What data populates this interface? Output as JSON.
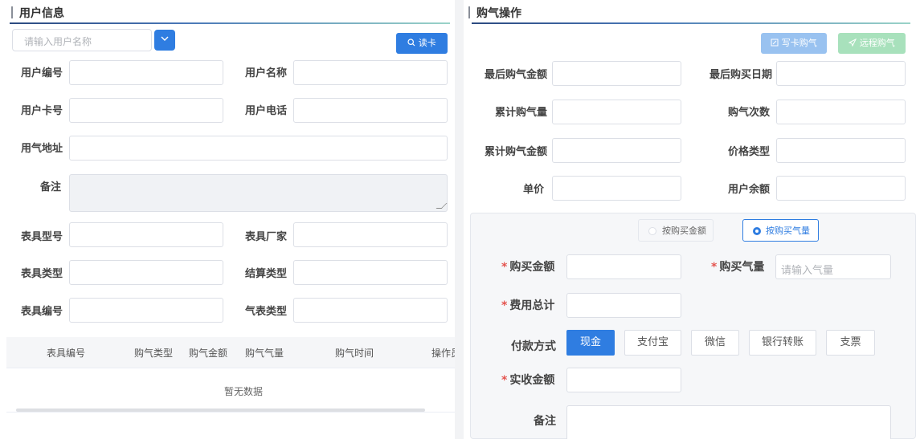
{
  "user_info": {
    "title": "用户信息",
    "search_placeholder": "请输入用户名称",
    "read_card_label": "读卡",
    "labels": {
      "user_no": "用户编号",
      "user_name": "用户名称",
      "card_no": "用户卡号",
      "phone": "用户电话",
      "address": "用气地址",
      "remark": "备注",
      "meter_model": "表具型号",
      "meter_maker": "表具厂家",
      "meter_type": "表具类型",
      "settle_type": "结算类型",
      "meter_no": "表具编号",
      "gas_meter_type": "气表类型"
    }
  },
  "table": {
    "columns": [
      "表具编号",
      "购气类型",
      "购气金额",
      "购气气量",
      "购气时间",
      "操作员"
    ],
    "empty_text": "暂无数据"
  },
  "purchase": {
    "title": "购气操作",
    "write_card_label": "写卡购气",
    "remote_label": "远程购气",
    "labels": {
      "last_amount": "最后购气金额",
      "last_date": "最后购买日期",
      "total_volume": "累计购气量",
      "count": "购气次数",
      "total_amount": "累计购气金额",
      "price_type": "价格类型",
      "unit_price": "单价",
      "balance": "用户余额"
    },
    "mode_options": [
      "按购买金额",
      "按购买气量"
    ],
    "mode_selected": "按购买气量",
    "form": {
      "buy_amount": "购买金额",
      "buy_volume": "购买气量",
      "buy_volume_placeholder": "请输入气量",
      "total_fee": "费用总计",
      "pay_method": "付款方式",
      "pay_options": [
        "现金",
        "支付宝",
        "微信",
        "银行转账",
        "支票"
      ],
      "pay_selected": "现金",
      "actual_amount": "实收金额",
      "remark": "备注"
    }
  },
  "colors": {
    "primary": "#2f7de1",
    "write_card_btn": "#99c2f0",
    "remote_btn": "#a8e1bc",
    "required": "#e4544f"
  }
}
